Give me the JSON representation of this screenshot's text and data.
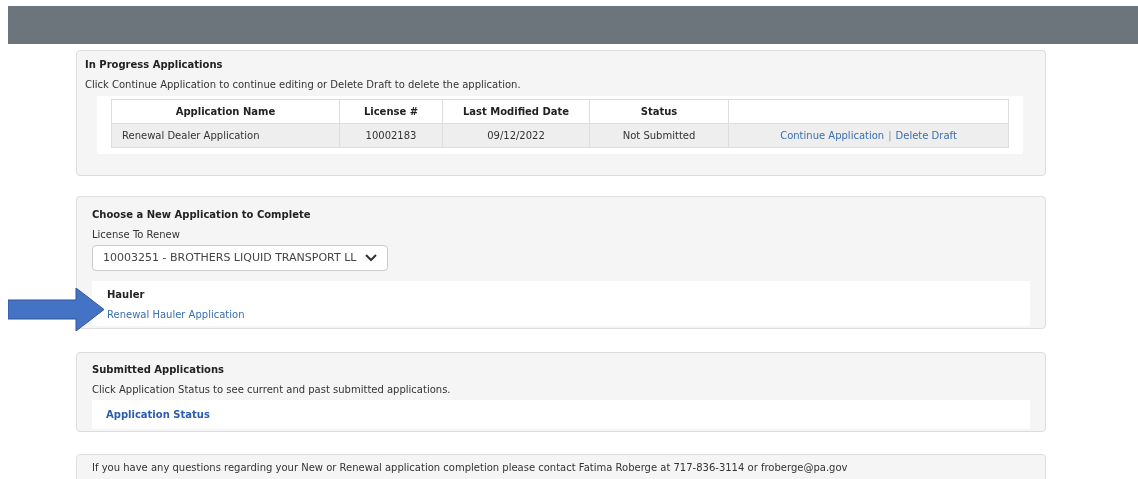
{
  "in_progress": {
    "title": "In Progress Applications",
    "instructions": "Click Continue Application to continue editing or Delete Draft to delete the application.",
    "columns": [
      "Application Name",
      "License #",
      "Last Modified Date",
      "Status"
    ],
    "rows": [
      {
        "name": "Renewal Dealer Application",
        "license": "10002183",
        "modified": "09/12/2022",
        "status": "Not Submitted",
        "continue_link": "Continue Application",
        "separator": "|",
        "delete_link": "Delete Draft"
      }
    ]
  },
  "new_application": {
    "title": "Choose a New Application to Complete",
    "license_label": "License To Renew",
    "license_value": "10003251 - BROTHERS LIQUID TRANSPORT LL",
    "group_title": "Hauler",
    "link": "Renewal Hauler Application"
  },
  "submitted": {
    "title": "Submitted Applications",
    "instructions": "Click Application Status to see current and past submitted applications.",
    "link": "Application Status"
  },
  "contact_note": "If you have any questions regarding your New or Renewal application completion please contact Fatima Roberge at 717-836-3114 or froberge@pa.gov"
}
